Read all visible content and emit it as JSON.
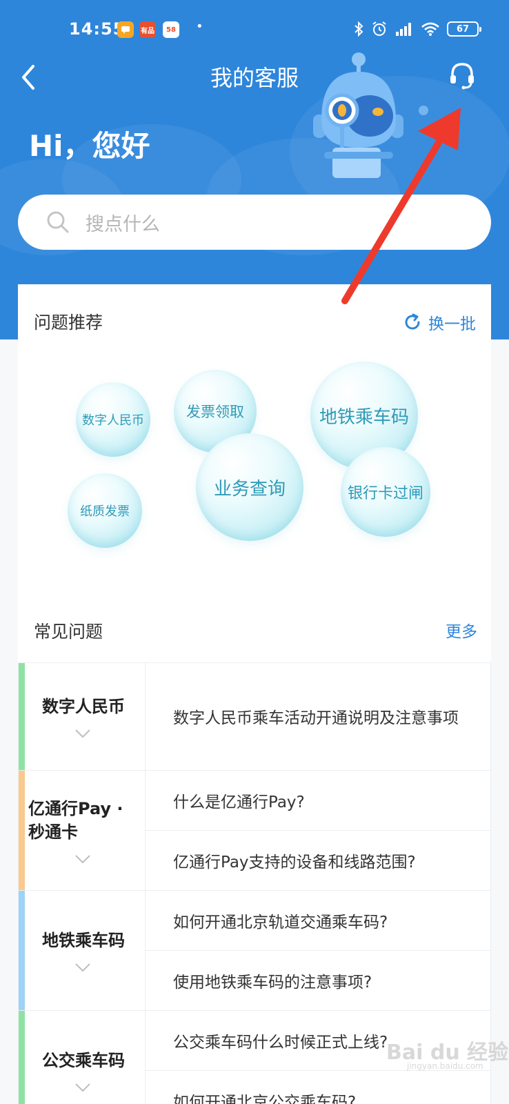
{
  "status_bar": {
    "time": "14:55",
    "apps": [
      {
        "icon": "chat-app-icon",
        "text": "",
        "color": "#f5a623"
      },
      {
        "icon": "shop-app-icon",
        "text": "有品",
        "color": "#e8502f"
      },
      {
        "icon": "58-app-icon",
        "text": "58",
        "color": "#ffffff"
      }
    ],
    "dot": "•",
    "battery": "67"
  },
  "nav": {
    "title": "我的客服"
  },
  "greeting": "Hi，您好",
  "search": {
    "placeholder": "搜点什么"
  },
  "recommend": {
    "title": "问题推荐",
    "refresh_label": "换一批",
    "bubbles": [
      {
        "label": "数字人民币"
      },
      {
        "label": "发票领取"
      },
      {
        "label": "地铁乘车码"
      },
      {
        "label": "业务查询"
      },
      {
        "label": "银行卡过闸"
      },
      {
        "label": "纸质发票"
      }
    ]
  },
  "faq": {
    "title": "常见问题",
    "more_label": "更多",
    "groups": [
      {
        "category": "数字人民币",
        "color": "#8ee3a4",
        "questions": [
          "数字人民币乘车活动开通说明及注意事项"
        ]
      },
      {
        "category": "亿通行Pay · 秒通卡",
        "color": "#f9c98d",
        "questions": [
          "什么是亿通行Pay?",
          "亿通行Pay支持的设备和线路范围?"
        ]
      },
      {
        "category": "地铁乘车码",
        "color": "#9fd2f7",
        "questions": [
          "如何开通北京轨道交通乘车码?",
          "使用地铁乘车码的注意事项?"
        ]
      },
      {
        "category": "公交乘车码",
        "color": "#8ee3a4",
        "questions": [
          "公交乘车码什么时候正式上线?",
          "如何开通北京公交乘车码?"
        ]
      }
    ]
  },
  "watermark": {
    "brand": "Bai du 经验",
    "url": "jingyan.baidu.com"
  },
  "colors": {
    "header": "#2e86db",
    "accent": "#2e86db",
    "bubble_text": "#2f9ab7",
    "annotation_arrow": "#ee3a2c"
  }
}
